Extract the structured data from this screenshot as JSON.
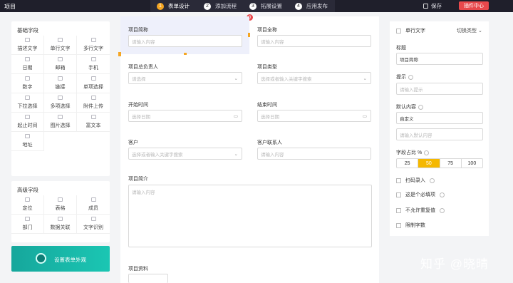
{
  "app": {
    "brand": "项目",
    "save_label": "保存",
    "upgrade_label": "插件中心"
  },
  "steps": [
    {
      "num": "1",
      "label": "表单设计"
    },
    {
      "num": "2",
      "label": "添加流程"
    },
    {
      "num": "3",
      "label": "拓展设置"
    },
    {
      "num": "4",
      "label": "应用发布"
    }
  ],
  "basic": {
    "title": "基础字段",
    "items": [
      "描述文字",
      "单行文字",
      "多行文字",
      "日期",
      "邮箱",
      "手机",
      "数字",
      "链接",
      "单项选择",
      "下拉选择",
      "多项选择",
      "附件上传",
      "起止时间",
      "图片选择",
      "富文本",
      "地址"
    ]
  },
  "advanced": {
    "title": "高级字段",
    "items": [
      "定位",
      "表格",
      "成员",
      "部门",
      "数据关联",
      "文字识别"
    ]
  },
  "cta": {
    "label": "设置表单外观"
  },
  "form": {
    "badge": "0",
    "fields": [
      {
        "label": "项目简称",
        "placeholder": "请输入内容"
      },
      {
        "label": "项目全称",
        "placeholder": "请输入内容"
      },
      {
        "label": "项目总负责人",
        "placeholder": "请选择"
      },
      {
        "label": "项目类型",
        "placeholder": "选择或者输入关键字搜索"
      },
      {
        "label": "开始时间",
        "placeholder": "选择日期"
      },
      {
        "label": "结束时间",
        "placeholder": "选择日期"
      },
      {
        "label": "客户",
        "placeholder": "选择或者输入关键字搜索"
      },
      {
        "label": "客户联系人",
        "placeholder": "请输入内容"
      }
    ],
    "intro": {
      "label": "项目简介",
      "placeholder": "请输入内容"
    },
    "docs": {
      "label": "项目资料"
    }
  },
  "props": {
    "type": "单行文字",
    "switch_type": "切换类型",
    "title_label": "标题",
    "title_value": "项目简称",
    "hint_label": "提示",
    "hint_placeholder": "请输入提示",
    "default_label": "默认内容",
    "default_select": "自定义",
    "default_placeholder": "请输入默认内容",
    "width_label": "字段占比 %",
    "width_options": [
      "25",
      "50",
      "75",
      "100"
    ],
    "width_selected": "50",
    "scan": "扫码录入",
    "required": "这是个必填项",
    "no_dup": "不允许重复值",
    "limit": "限制字数"
  },
  "watermark": "知乎 @晓晴"
}
